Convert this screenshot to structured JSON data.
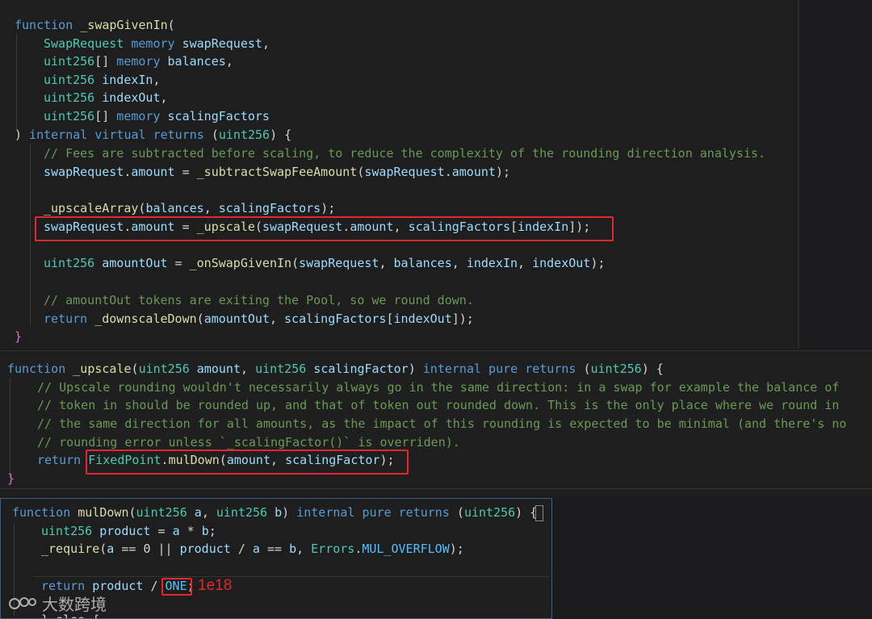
{
  "snippet1": {
    "l1": {
      "a": "function",
      "b": " _swapGivenIn",
      "c": "("
    },
    "l2": {
      "a": "SwapRequest",
      "b": " memory",
      "c": " swapRequest",
      ",": ","
    },
    "l3": {
      "a": "uint256",
      "b": "[]",
      "c": " memory",
      "d": " balances",
      ",": ","
    },
    "l4": {
      "a": "uint256",
      "b": " indexIn",
      ",": ","
    },
    "l5": {
      "a": "uint256",
      "b": " indexOut",
      ",": ","
    },
    "l6": {
      "a": "uint256",
      "b": "[]",
      "c": " memory",
      "d": " scalingFactors"
    },
    "l7": {
      "a": ")",
      "b": " internal",
      "c": " virtual",
      "d": " returns",
      "e": " (",
      "f": "uint256",
      "g": ")",
      "h": " {"
    },
    "l8": {
      "a": "// Fees are subtracted before scaling, to reduce the complexity of the rounding direction analysis."
    },
    "l9": {
      "a": "swapRequest",
      "b": ".",
      "c": "amount",
      "d": " = ",
      "e": "_subtractSwapFeeAmount",
      "f": "(",
      "g": "swapRequest",
      "h": ".",
      "i": "amount",
      "j": ");"
    },
    "l11": {
      "a": "_upscaleArray",
      "b": "(",
      "c": "balances",
      ",": ", ",
      "d": "scalingFactors",
      "e": ");"
    },
    "l12": {
      "a": "swapRequest",
      "b": ".",
      "c": "amount",
      "d": " = ",
      "e": "_upscale",
      "f": "(",
      "g": "swapRequest",
      "h": ".",
      "i": "amount",
      ",": ", ",
      "j": "scalingFactors",
      "k": "[",
      "l": "indexIn",
      "m": "]",
      "n": ");"
    },
    "l14": {
      "a": "uint256",
      "b": " amountOut",
      "c": " = ",
      "d": "_onSwapGivenIn",
      "e": "(",
      "f": "swapRequest",
      ",": ", ",
      "g": "balances",
      "h": ", ",
      "i": "indexIn",
      "j": ", ",
      "k": "indexOut",
      "l": ");"
    },
    "l16": {
      "a": "// amountOut tokens are exiting the Pool, so we round down."
    },
    "l17": {
      "a": "return",
      "b": " _downscaleDown",
      "c": "(",
      "d": "amountOut",
      ",": ", ",
      "e": "scalingFactors",
      "f": "[",
      "g": "indexOut",
      "h": "]",
      "i": ");"
    },
    "l18": {
      "a": "}"
    }
  },
  "snippet2": {
    "l1": {
      "a": "function",
      "b": " _upscale",
      "c": "(",
      "d": "uint256",
      "e": " amount",
      ",": ", ",
      "f": "uint256",
      "g": " scalingFactor",
      "h": ")",
      "i": " internal",
      "j": " pure",
      "k": " returns",
      "l": " (",
      "m": "uint256",
      "n": ")",
      "o": " {"
    },
    "l2": {
      "a": "// Upscale rounding wouldn't necessarily always go in the same direction: in a swap for example the balance of"
    },
    "l3": {
      "a": "// token in should be rounded up, and that of token out rounded down. This is the only place where we round in"
    },
    "l4": {
      "a": "// the same direction for all amounts, as the impact of this rounding is expected to be minimal (and there's no"
    },
    "l5": {
      "a": "// rounding error unless `_scalingFactor()` is overriden)."
    },
    "l6": {
      "a": "return",
      "b": " FixedPoint",
      "c": ".",
      "d": "mulDown",
      "e": "(",
      "f": "amount",
      ",": ", ",
      "g": "scalingFactor",
      "h": ");"
    },
    "l7": {
      "a": "}"
    }
  },
  "snippet3": {
    "l1": {
      "a": "function",
      "b": " mulDown",
      "c": "(",
      "d": "uint256",
      "e": " a",
      ",": ", ",
      "f": "uint256",
      "g": " b",
      "h": ")",
      "i": " internal",
      "j": " pure",
      "k": " returns",
      "l": " (",
      "m": "uint256",
      "n": ")",
      "o": " {"
    },
    "l2": {
      "a": "uint256",
      "b": " product",
      "c": " = ",
      "d": "a",
      "e": " * ",
      "f": "b",
      "g": ";"
    },
    "l3": {
      "a": "_require",
      "b": "(",
      "c": "a",
      "d": " == ",
      "e": "0",
      "f": " || ",
      "g": "product",
      "h": " / ",
      "i": "a",
      "j": " == ",
      "k": "b",
      ",": ", ",
      "l": "Errors",
      "m": ".",
      "n": "MUL_OVERFLOW",
      "o": ");"
    },
    "l5": {
      "a": "return",
      "b": " product",
      "c": " / ",
      "d": "ONE",
      "e": ";"
    },
    "l6": {
      "a": "} else {"
    }
  },
  "annotation": "1e18",
  "watermark": "大数跨境"
}
